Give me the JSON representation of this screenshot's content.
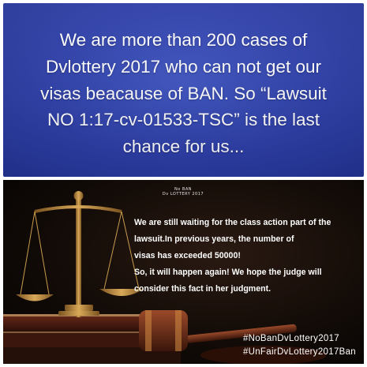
{
  "top": {
    "lines": [
      "We are more than 200 cases of",
      "Dvlottery 2017 who can not get our",
      "visas beacause of BAN. So “Lawsuit",
      "NO 1:17-cv-01533-TSC” is the last",
      "chance for us..."
    ]
  },
  "logo": {
    "line1": "No BAN",
    "line2": "Dv LOTTERY 2017"
  },
  "body": {
    "p1_line1": "We are still waiting for the class action part of the",
    "p1_line2": "lawsuit.In previous years, the number of",
    "p1_line3": "visas has exceeded 50000!",
    "p2_line1": "So, it will happen again! We hope the judge will",
    "p2_line2": "consider this fact in her judgment."
  },
  "hashtags": [
    "#NoBanDvLottery2017",
    "#UnFairDvLottery2017Ban"
  ],
  "colors": {
    "top_bg": "#2d3ea8",
    "bottom_bg": "#120b07",
    "text": "#ffffff",
    "brass": "#b8863a"
  }
}
